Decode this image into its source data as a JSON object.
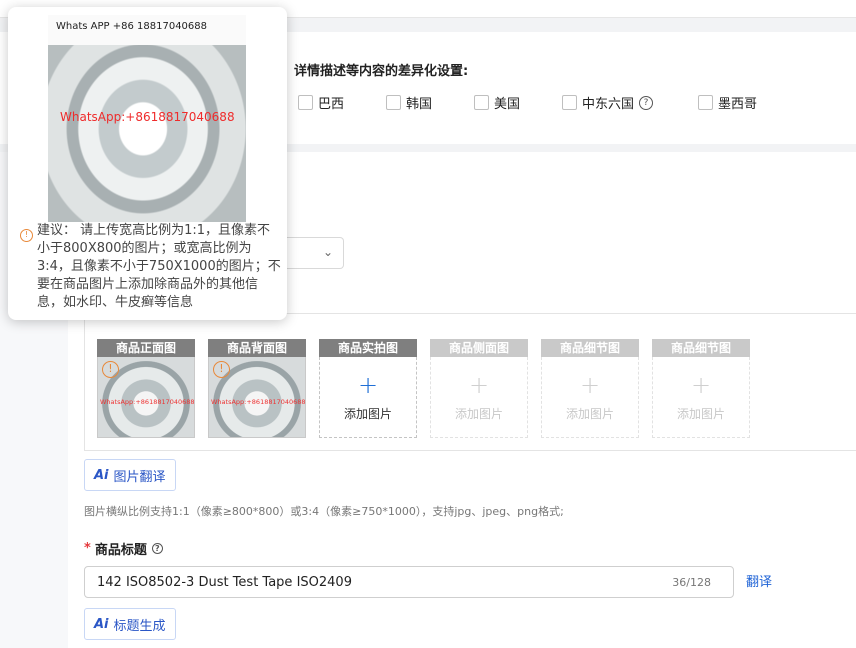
{
  "regions": {
    "title": "详情描述等内容的差异化设置:",
    "countries": [
      {
        "label": "巴西",
        "checked": false
      },
      {
        "label": "韩国",
        "checked": false
      },
      {
        "label": "美国",
        "checked": false
      },
      {
        "label": "中东六国",
        "checked": false,
        "help_icon": "question-circle-icon"
      },
      {
        "label": "墨西哥",
        "checked": false
      }
    ]
  },
  "images": {
    "slots": [
      {
        "label": "商品正面图",
        "state": "filled",
        "watermark": "WhatsApp:+8618817040688"
      },
      {
        "label": "商品背面图",
        "state": "filled",
        "watermark": "WhatsApp:+8618817040688"
      },
      {
        "label": "商品实拍图",
        "state": "add",
        "add_label": "添加图片"
      },
      {
        "label": "商品侧面图",
        "state": "disabled",
        "add_label": "添加图片"
      },
      {
        "label": "商品细节图",
        "state": "disabled",
        "add_label": "添加图片"
      },
      {
        "label": "商品细节图",
        "state": "disabled",
        "add_label": "添加图片"
      }
    ],
    "translate_button": "图片翻译",
    "hint": "图片横纵比例支持1:1（像素≥800*800）或3:4（像素≥750*1000），支持jpg、jpeg、png格式;"
  },
  "product_title": {
    "label": "商品标题",
    "required_mark": "*",
    "value": "142 ISO8502-3 Dust Test Tape ISO2409",
    "count": "36/128",
    "translate_link": "翻译",
    "generate_button": "标题生成"
  },
  "tooltip": {
    "image_top_text": "Whats APP +86 18817040688",
    "image_watermark": "WhatsApp:+8618817040688",
    "text": "建议：  请上传宽高比例为1:1，且像素不小于800X800的图片；或宽高比例为3:4，且像素不小于750X1000的图片；不要在商品图片上添加除商品外的其他信息，如水印、牛皮癣等信息"
  },
  "colors": {
    "accent": "#1f63d6",
    "required": "#e4393c",
    "warning": "#e8893a"
  }
}
